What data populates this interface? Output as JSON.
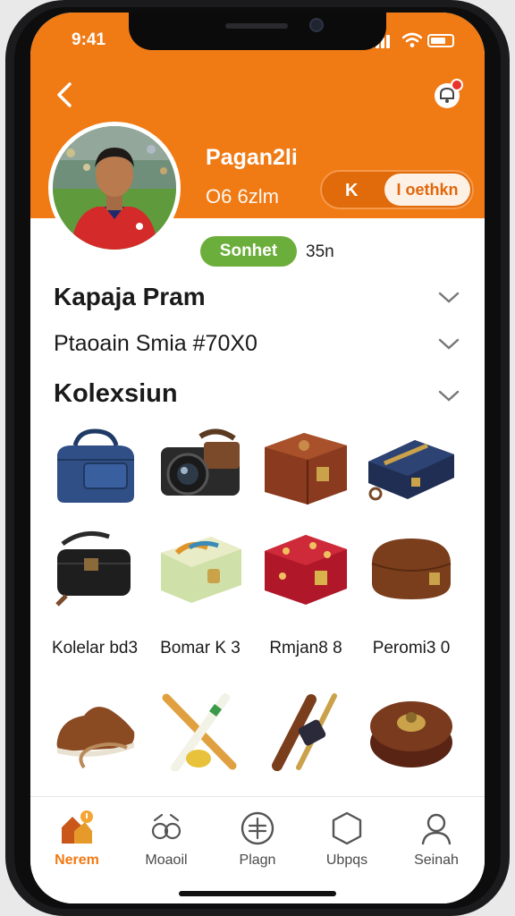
{
  "status_bar": {
    "time": "9:41"
  },
  "profile": {
    "username": "Pagan2li",
    "subtitle": "O6 6zlm",
    "follow_button": {
      "leading": "K",
      "label": "I oethkn"
    },
    "status_badge": "Sonhet",
    "badge_count": "35n"
  },
  "sections": {
    "section_1": "Kapaja Pram",
    "section_2": "Ptaoain Smia #70X0",
    "section_3": "Kolexsiun"
  },
  "collection": {
    "labels": [
      "Kolelar bd3",
      "Bomar K 3",
      "Rmjan8 8",
      "Peromi3 0"
    ]
  },
  "bottom_nav": [
    {
      "label": "Nerem",
      "icon": "home-icon",
      "active": true
    },
    {
      "label": "Moaoil",
      "icon": "people-icon",
      "active": false
    },
    {
      "label": "Plagn",
      "icon": "plus-circle-icon",
      "active": false
    },
    {
      "label": "Ubpqs",
      "icon": "hexagon-icon",
      "active": false
    },
    {
      "label": "Seinah",
      "icon": "user-icon",
      "active": false
    }
  ],
  "colors": {
    "brand": "#f07a14",
    "badge": "#6cae3b",
    "active_nav": "#f07a14"
  }
}
